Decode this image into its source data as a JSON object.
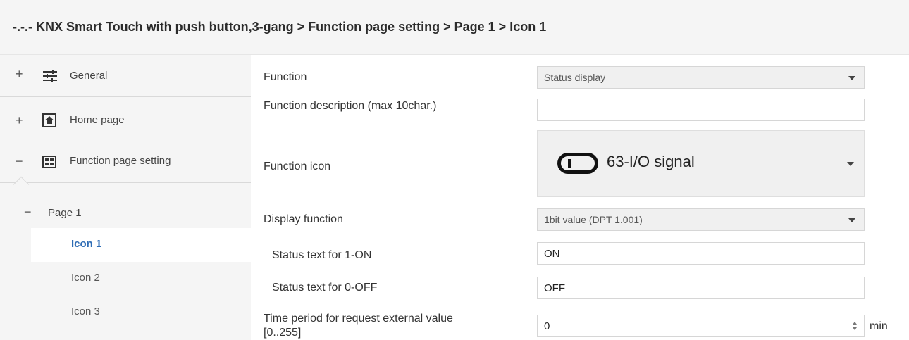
{
  "header": {
    "breadcrumb": "-.-.- KNX Smart Touch with push button,3-gang > Function page setting > Page 1 > Icon 1"
  },
  "sidebar": {
    "items": [
      {
        "sign": "+",
        "icon": "sliders-icon",
        "label": "General"
      },
      {
        "sign": "+",
        "icon": "home-icon",
        "label": "Home page"
      },
      {
        "sign": "−",
        "icon": "grid-icon",
        "label": "Function page setting"
      }
    ],
    "page": {
      "sign": "−",
      "label": "Page 1"
    },
    "icons": [
      {
        "label": "Icon 1",
        "active": true
      },
      {
        "label": "Icon 2",
        "active": false
      },
      {
        "label": "Icon 3",
        "active": false
      }
    ]
  },
  "params": {
    "function": {
      "label": "Function",
      "value": "Status display"
    },
    "description": {
      "label": "Function description (max 10char.)",
      "value": ""
    },
    "icon": {
      "label": "Function icon",
      "value": "63-I/O signal",
      "icon": "toggle-switch-icon"
    },
    "display": {
      "label": "Display function",
      "value": "1bit value (DPT 1.001)"
    },
    "on_text": {
      "label": "Status text for 1-ON",
      "value": "ON"
    },
    "off_text": {
      "label": "Status text for 0-OFF",
      "value": "OFF"
    },
    "period": {
      "label_line1": "Time period for request external value",
      "label_line2": "[0..255]",
      "value": "0",
      "unit": "min"
    }
  }
}
